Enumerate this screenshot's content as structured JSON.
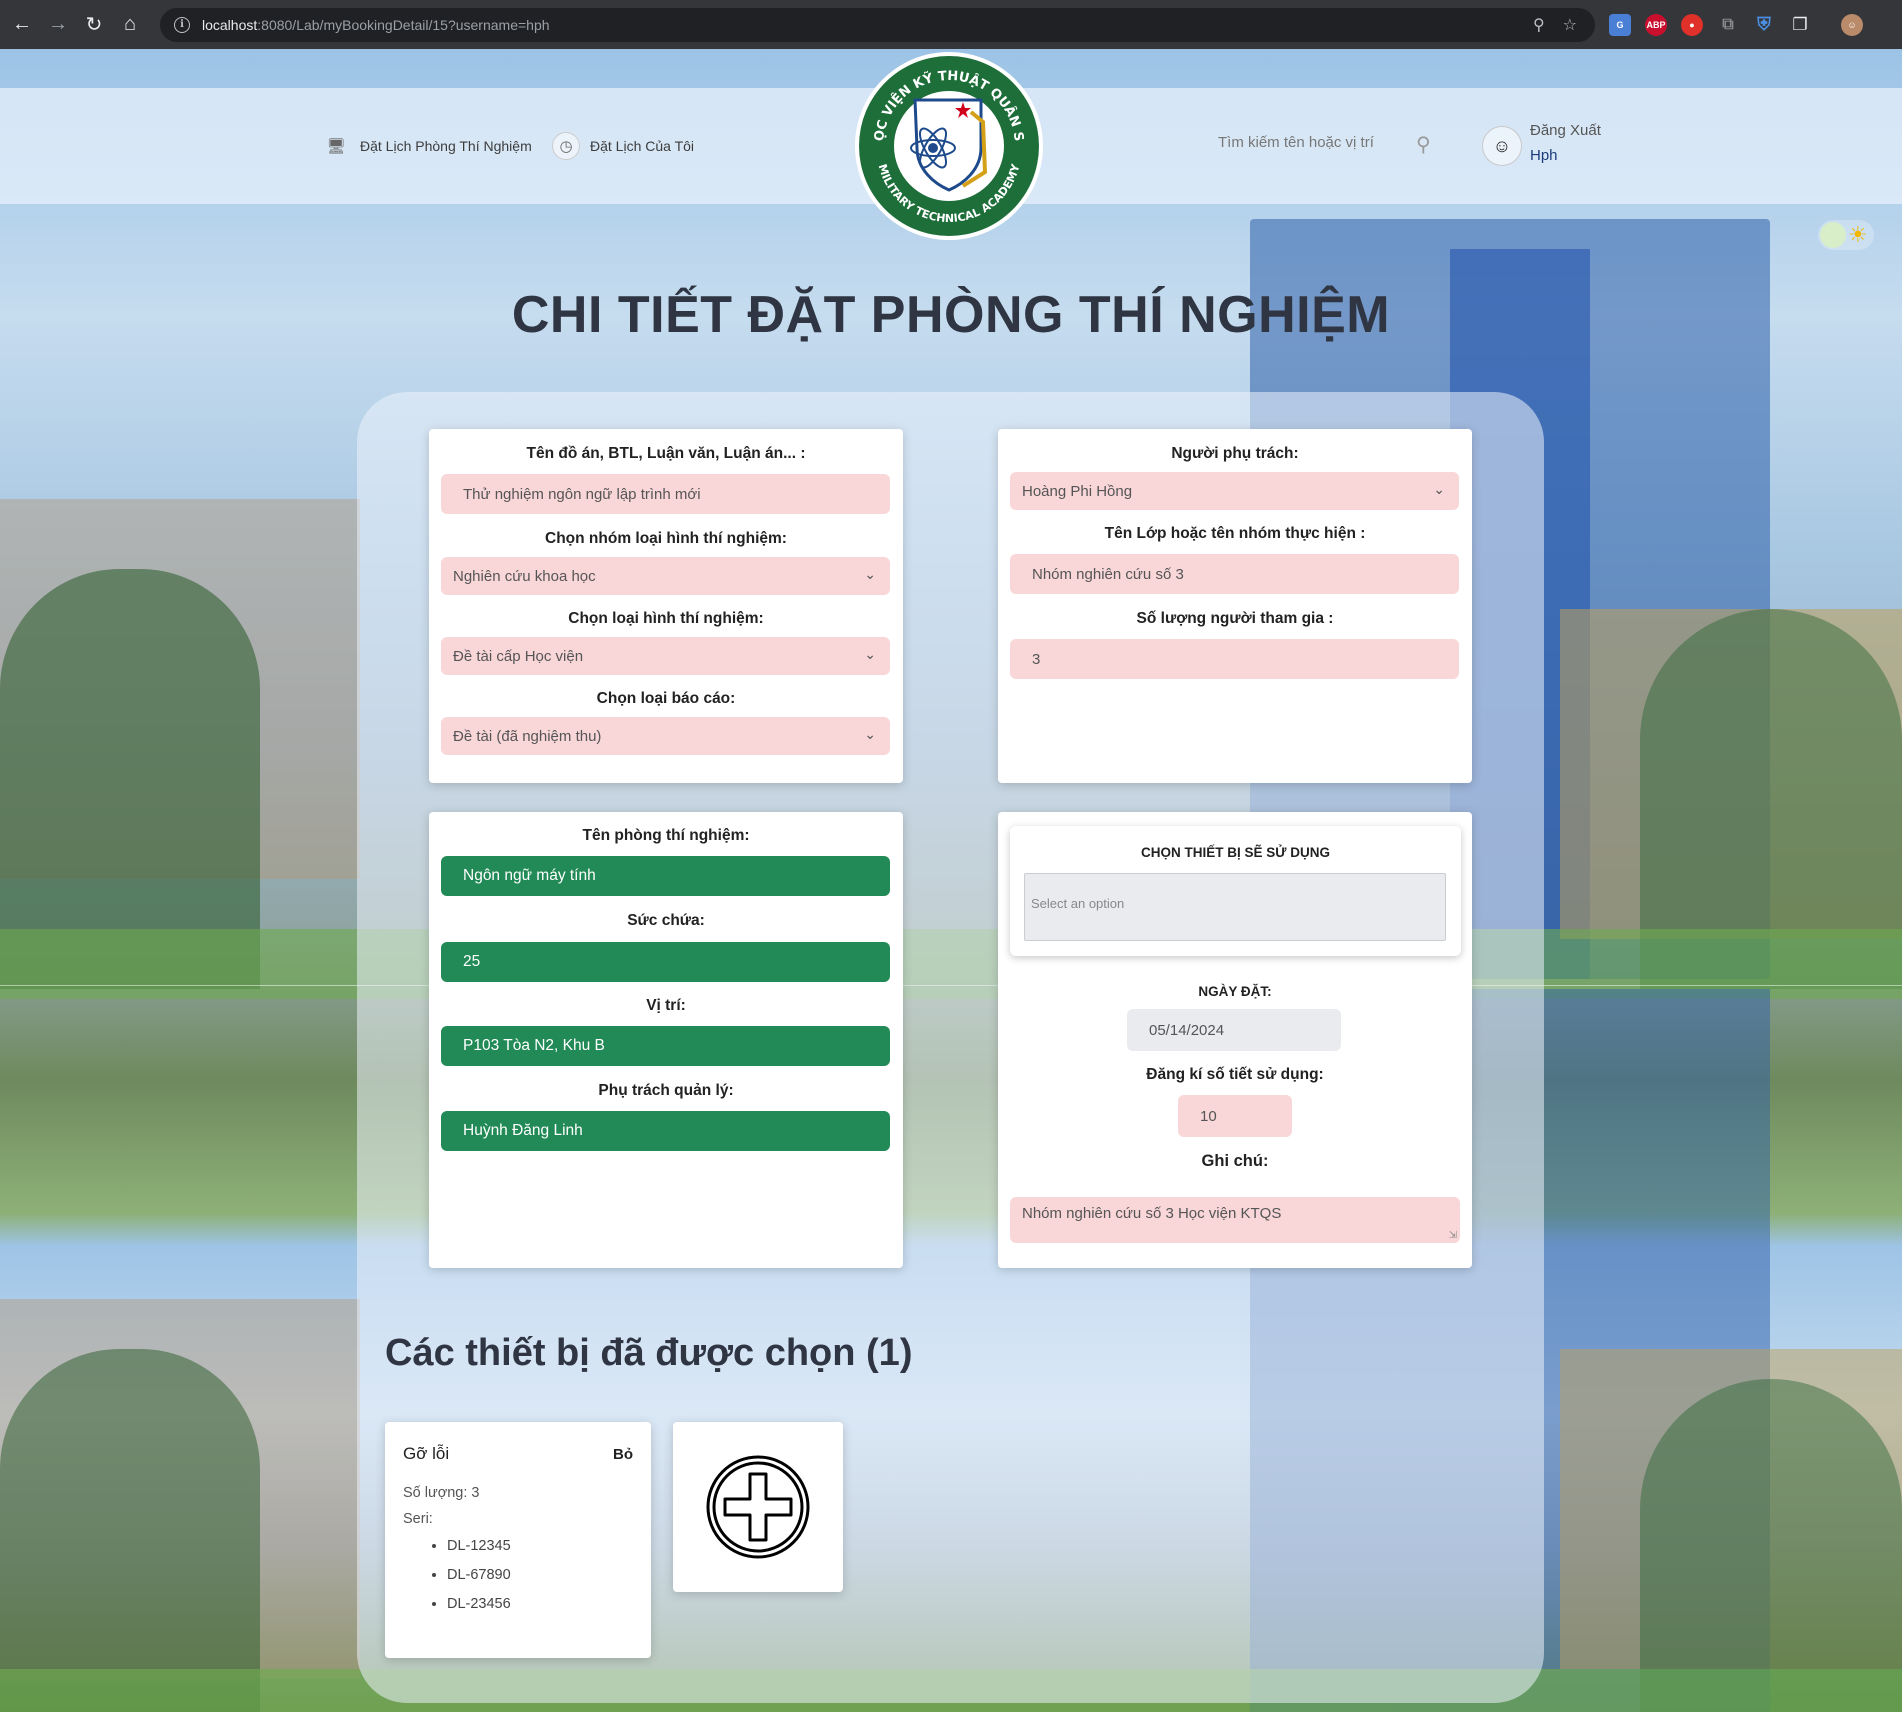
{
  "browser": {
    "url_host": "localhost",
    "url_path": ":8080/Lab/myBookingDetail/15?username=hph",
    "ext_abp": "ABP"
  },
  "header": {
    "nav": [
      {
        "label": "Đặt Lịch Phòng Thí Nghiệm",
        "icon": "monitor-icon"
      },
      {
        "label": "Đặt Lịch Của Tôi",
        "icon": "clock-icon"
      }
    ],
    "search_placeholder": "Tìm kiếm tên hoặc vị trí",
    "logout_label": "Đăng Xuất",
    "username": "Hph",
    "logo": {
      "top_text": "HỌC VIỆN KỸ THUẬT QUÂN SỰ",
      "bottom_text": "MILITARY TECHNICAL ACADEMY",
      "green": "#1e6e3a"
    }
  },
  "title": "CHI TIẾT ĐẶT PHÒNG THÍ NGHIỆM",
  "project_card": {
    "project_label": "Tên đồ án, BTL, Luận văn, Luận án... :",
    "project_value": "Thử nghiệm ngôn ngữ lập trình mới",
    "group_label": "Chọn nhóm loại hình thí nghiệm:",
    "group_value": "Nghiên cứu khoa học",
    "type_label": "Chọn loại hình thí nghiệm:",
    "type_value": "Đề tài cấp Học viện",
    "report_label": "Chọn loại báo cáo:",
    "report_value": "Đề tài (đã nghiệm thu)"
  },
  "person_card": {
    "responsible_label": "Người phụ trách:",
    "responsible_value": "Hoàng Phi Hồng",
    "class_label": "Tên Lớp hoặc tên nhóm thực hiện :",
    "class_value": "Nhóm nghiên cứu số 3",
    "count_label": "Số lượng người tham gia :",
    "count_value": "3"
  },
  "lab_card": {
    "name_label": "Tên phòng thí nghiệm:",
    "name_value": "Ngôn ngữ máy tính",
    "capacity_label": "Sức chứa:",
    "capacity_value": "25",
    "location_label": "Vị trí:",
    "location_value": "P103 Tòa N2, Khu B",
    "manager_label": "Phụ trách quản lý:",
    "manager_value": "Huỳnh Đăng Linh"
  },
  "booking_card": {
    "equipment_title": "CHỌN THIẾT BỊ SẼ SỬ DỤNG",
    "equipment_placeholder": "Select an option",
    "date_label": "NGÀY ĐẶT:",
    "date_value": "05/14/2024",
    "periods_label": "Đăng kí số tiết sử dụng:",
    "periods_value": "10",
    "notes_label": "Ghi chú:",
    "notes_value": "Nhóm nghiên cứu số 3 Học viện KTQS"
  },
  "devices": {
    "heading": "Các thiết bị đã được chọn (1)",
    "items": [
      {
        "name": "Gỡ lỗi",
        "remove_label": "Bỏ",
        "quantity": "Số lượng: 3",
        "serial_label": "Seri:",
        "serials": [
          "DL-12345",
          "DL-67890",
          "DL-23456"
        ]
      }
    ]
  },
  "colors": {
    "pink_field": "#f9d7d9",
    "green_field": "#218a56",
    "title": "#2f3542"
  }
}
